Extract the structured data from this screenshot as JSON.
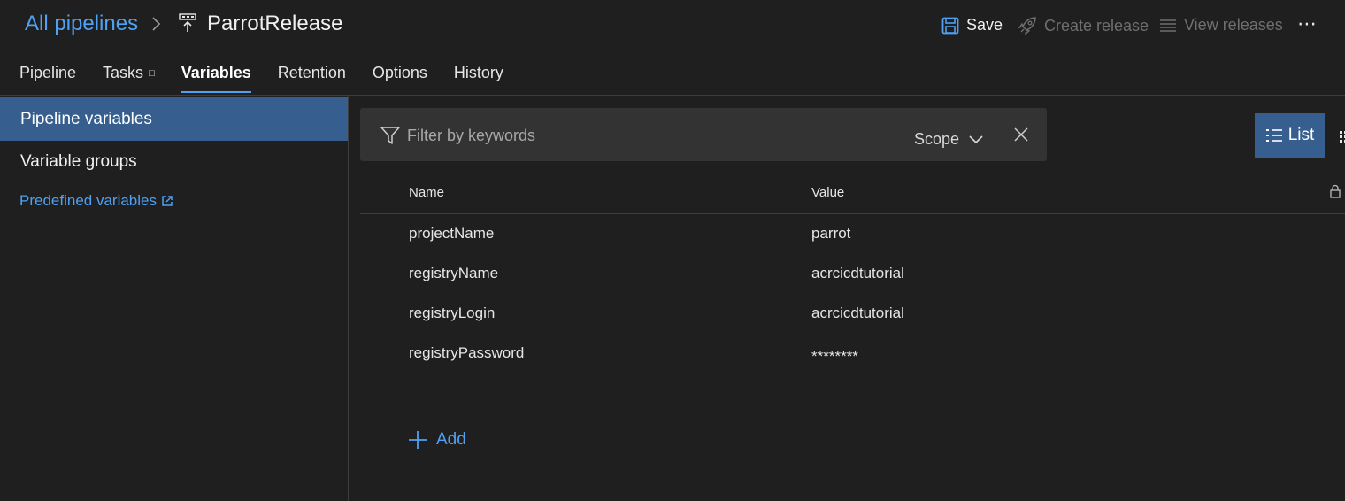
{
  "header": {
    "breadcrumb_link": "All pipelines",
    "pipeline_name": "ParrotRelease",
    "save_label": "Save",
    "create_release_label": "Create release",
    "view_releases_label": "View releases",
    "more_label": "⋯"
  },
  "tabs": [
    {
      "label": "Pipeline"
    },
    {
      "label": "Tasks",
      "badge": "□"
    },
    {
      "label": "Variables",
      "active": true
    },
    {
      "label": "Retention"
    },
    {
      "label": "Options"
    },
    {
      "label": "History"
    }
  ],
  "sidebar": {
    "active_item": "Pipeline variables",
    "item": "Variable groups",
    "link": "Predefined variables"
  },
  "filter": {
    "placeholder": "Filter by keywords",
    "scope_label": "Scope"
  },
  "view": {
    "list_label": "List"
  },
  "table": {
    "columns": {
      "name": "Name",
      "value": "Value"
    },
    "rows": [
      {
        "name": "projectName",
        "value": "parrot"
      },
      {
        "name": "registryName",
        "value": "acrcicdtutorial"
      },
      {
        "name": "registryLogin",
        "value": "acrcicdtutorial"
      },
      {
        "name": "registryPassword",
        "value": "********"
      }
    ]
  },
  "actions": {
    "add_label": "Add"
  },
  "colors": {
    "accent": "#4ea1f3",
    "selected_bg": "#365f8f",
    "background": "#1f1f1f"
  }
}
